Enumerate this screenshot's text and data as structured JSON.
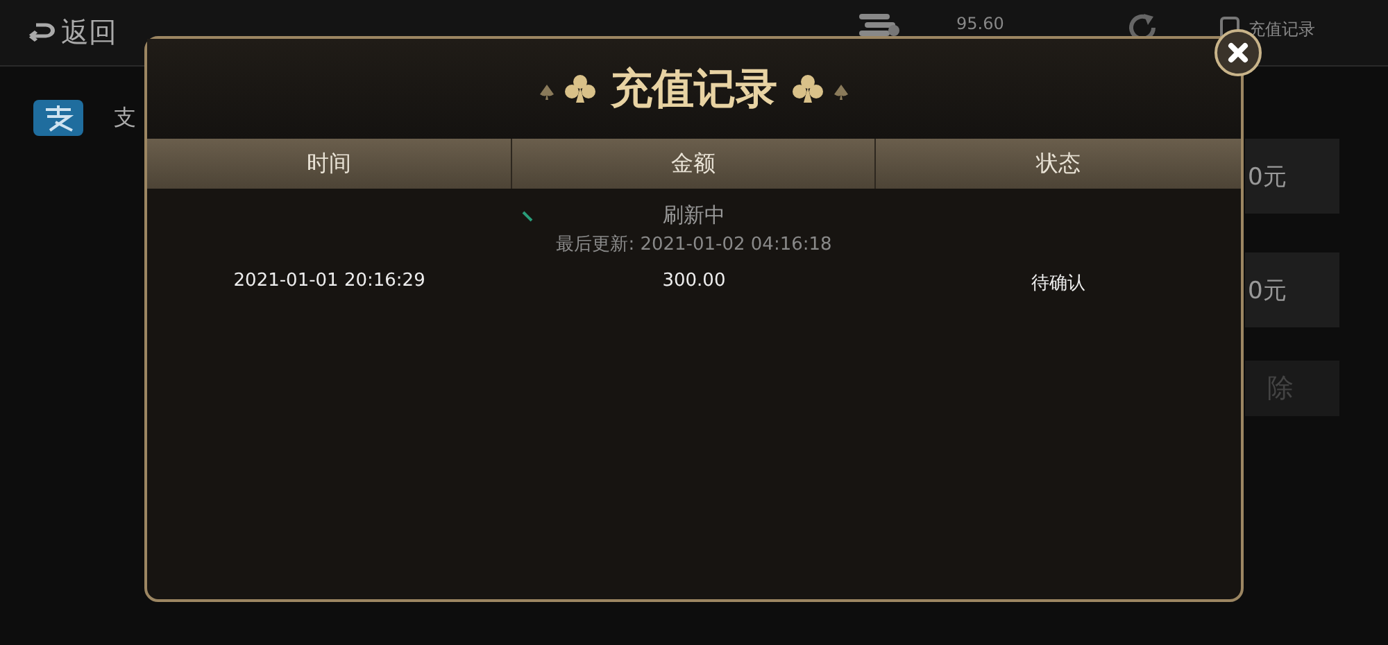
{
  "top_bar": {
    "back": "返回",
    "balance": "95.60",
    "record_link": "充值记录"
  },
  "sidebar": {
    "items": [
      {
        "label": "支"
      }
    ]
  },
  "amount_buttons": [
    "0元",
    "0元"
  ],
  "clear_button": "除",
  "dialog": {
    "title": "充值记录",
    "columns": [
      "时间",
      "金额",
      "状态"
    ],
    "loading": {
      "text": "刷新中",
      "last_update": "最后更新: 2021-01-02 04:16:18"
    },
    "rows": [
      {
        "cells": [
          "2021-01-01 20:16:29",
          "300.00",
          "待确认"
        ]
      }
    ]
  }
}
